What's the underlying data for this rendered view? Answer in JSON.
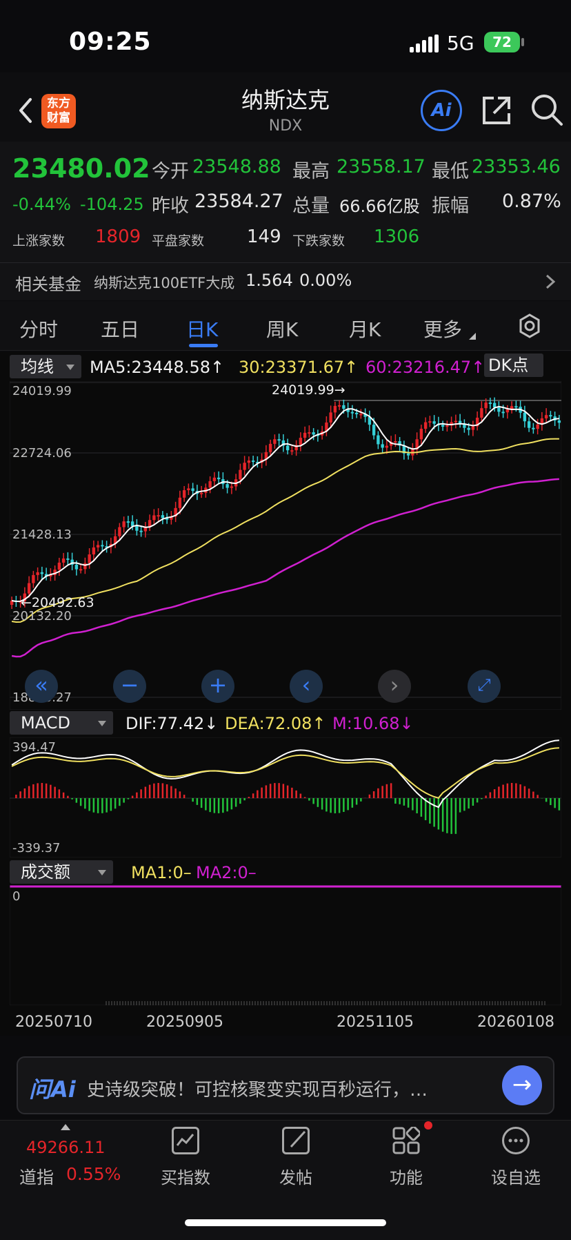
{
  "status_bar": {
    "time": "09:25",
    "network": "5G",
    "battery": "72"
  },
  "header": {
    "title": "纳斯达克",
    "subtitle": "NDX",
    "logo_text": "东方财富",
    "ai_label": "Ai"
  },
  "quote": {
    "price": "23480.02",
    "change_pct": "-0.44%",
    "change": "-104.25",
    "open_label": "今开",
    "open": "23548.88",
    "high_label": "最高",
    "high": "23558.17",
    "low_label": "最低",
    "low": "23353.46",
    "prev_close_label": "昨收",
    "prev_close": "23584.27",
    "volume_label": "总量",
    "volume": "66.66亿股",
    "amplitude_label": "振幅",
    "amplitude": "0.87%",
    "up_label": "上涨家数",
    "up_count": "1809",
    "flat_label": "平盘家数",
    "flat_count": "149",
    "down_label": "下跌家数",
    "down_count": "1306"
  },
  "fund": {
    "label": "相关基金",
    "name": "纳斯达克100ETF大成",
    "price": "1.564",
    "change": "0.00%"
  },
  "tabs": [
    {
      "label": "分时"
    },
    {
      "label": "五日"
    },
    {
      "label": "日K"
    },
    {
      "label": "周K"
    },
    {
      "label": "月K"
    },
    {
      "label": "更多"
    }
  ],
  "kline": {
    "indicator_select": "均线",
    "ma5_label": "MA5:23448.58↑",
    "ma30_label": "30:23371.67↑",
    "ma60_label": "60:23216.47↑",
    "dk_label": "DK点",
    "y_labels": [
      "24019.99",
      "22724.06",
      "21428.13",
      "20132.20",
      "18836.27"
    ],
    "max_marker": "24019.99→",
    "min_marker": "←20492.63",
    "colors": {
      "ma5": "#ffffff",
      "ma30": "#f0e060",
      "ma60": "#d020d0",
      "up": "#e5252a",
      "down": "#35d0d8"
    }
  },
  "macd": {
    "indicator_select": "MACD",
    "dif_label": "DIF:77.42↓",
    "dea_label": "DEA:72.08↑",
    "m_label": "M:10.68↓",
    "y_top": "394.47",
    "y_bottom": "-339.37"
  },
  "volume": {
    "indicator_select": "成交额",
    "ma1_label": "MA1:0–",
    "ma2_label": "MA2:0–",
    "y_zero": "0"
  },
  "dates": [
    "20250710",
    "20250905",
    "20251105",
    "20260108"
  ],
  "ask": {
    "logo": "问Ai",
    "text": "史诗级突破！可控核聚变实现百秒运行，…"
  },
  "bottom_nav": {
    "index_value": "49266.11",
    "index_name": "道指",
    "index_change": "0.55%",
    "items": [
      {
        "label": "买指数"
      },
      {
        "label": "发帖"
      },
      {
        "label": "功能"
      },
      {
        "label": "设自选"
      }
    ]
  }
}
